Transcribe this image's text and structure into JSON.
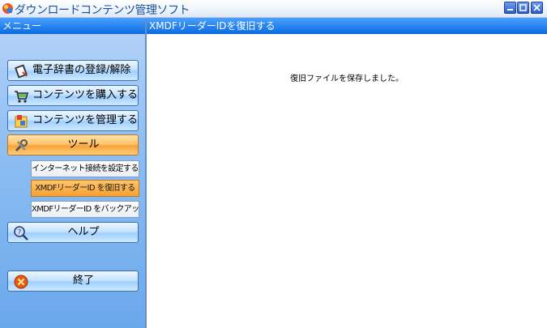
{
  "window": {
    "title": "ダウンロードコンテンツ管理ソフト",
    "controls": [
      "minimize-icon",
      "maximize-icon",
      "close-icon"
    ]
  },
  "sidebar": {
    "header": "メニュー",
    "items": [
      {
        "label": "電子辞書の登録/解除",
        "icon": "dictionary-register-icon"
      },
      {
        "label": "コンテンツを購入する",
        "icon": "shopping-cart-icon"
      },
      {
        "label": "コンテンツを管理する",
        "icon": "manage-contents-icon"
      },
      {
        "label": "ツール",
        "icon": "tools-icon",
        "active": true
      },
      {
        "label": "ヘルプ",
        "icon": "help-icon"
      },
      {
        "label": "終了",
        "icon": "exit-icon"
      }
    ],
    "tool_subitems": [
      {
        "label": "インターネット接続を設定する"
      },
      {
        "label": "XMDFリーダーID を復旧する",
        "active": true
      },
      {
        "label": "XMDFリーダーID をバックアップする"
      }
    ]
  },
  "content": {
    "header": "XMDFリーダーIDを復旧する",
    "message": "復旧ファイルを保存しました。"
  },
  "colors": {
    "header_blue": "#0a6be0",
    "active_orange": "#f7a43a",
    "sidebar_blue": "#8fbff2"
  }
}
